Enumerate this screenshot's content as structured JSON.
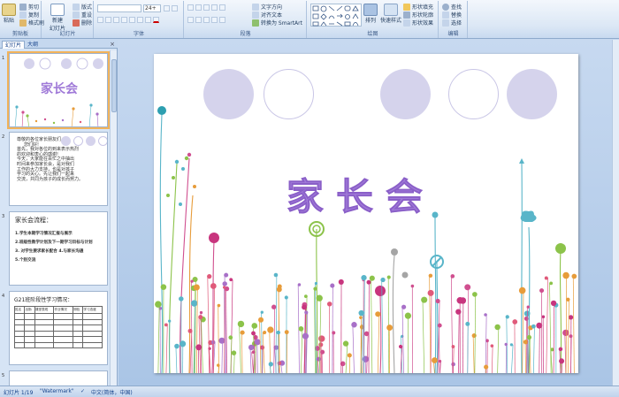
{
  "ribbon": {
    "clipboard": {
      "paste": "粘贴",
      "cut": "剪切",
      "copy": "复制",
      "format_painter": "格式刷",
      "group": "剪贴板"
    },
    "slides": {
      "new_slide": "新建\n幻灯片",
      "layout": "版式",
      "reset": "重设",
      "delete": "删除",
      "group": "幻灯片"
    },
    "font": {
      "size": "24+",
      "group": "字体"
    },
    "paragraph": {
      "text_direction": "文字方向",
      "align_text": "对齐文本",
      "smartart": "转换为 SmartArt",
      "group": "段落"
    },
    "drawing": {
      "arrange": "排列",
      "quick_styles": "快速样式",
      "shape_fill": "形状填充",
      "shape_outline": "形状轮廓",
      "shape_effects": "形状效果",
      "group": "绘图"
    },
    "editing": {
      "find": "查找",
      "replace": "替换",
      "select": "选择",
      "group": "编辑"
    }
  },
  "leftpane": {
    "tab_slides": "幻灯片",
    "tab_outline": "大纲",
    "close": "×",
    "thumbs": [
      {
        "num": "1",
        "title": "家长会"
      },
      {
        "num": "2",
        "lines": [
          "尊敬的各位家长朋友们",
          "您们好!",
          "首先，我对各位的到来表示热烈",
          "的欢迎和衷心的感谢!",
          "今天，大家能在百忙之中抽出",
          "时间来参加家长会，是对我们",
          "工作的大力支持，也是对孩子",
          "学习的关心。先让我们一起来",
          "交流，共同为孩子的成长而努力。"
        ]
      },
      {
        "num": "3",
        "title": "家长会流程：",
        "items": [
          "1.学生本期学习情况汇报与展示",
          "2.班级性教学计划及下一期学习目标与计划",
          "3. 对学生要求家长配合   4.与家长沟通",
          "5.个别交流"
        ]
      },
      {
        "num": "4",
        "title": "G21班阶段性学习情况：",
        "headers": [
          "姓名",
          "出勤",
          "课堂表现",
          "作业情况",
          "测验",
          "学习态度"
        ],
        "rows": [
          [
            "",
            "",
            "",
            "",
            "",
            ""
          ],
          [
            "",
            "",
            "",
            "",
            "",
            ""
          ],
          [
            "",
            "",
            "",
            "",
            "",
            ""
          ],
          [
            "",
            "",
            "",
            "",
            "",
            ""
          ],
          [
            "",
            "",
            "",
            "",
            "",
            ""
          ],
          [
            "",
            "",
            "",
            "",
            "",
            ""
          ]
        ]
      },
      {
        "num": "5"
      }
    ]
  },
  "slide": {
    "title": "家长会"
  },
  "statusbar": {
    "slide_info": "幻灯片 1/19",
    "theme": "\"Watermark\"",
    "language": "中文(简体，中国)"
  },
  "colors": {
    "title_purple": "#a07ad8",
    "circle_fill": "#d5d3ec",
    "circle_border": "#c9c6e6",
    "selection": "#f2b35a"
  }
}
